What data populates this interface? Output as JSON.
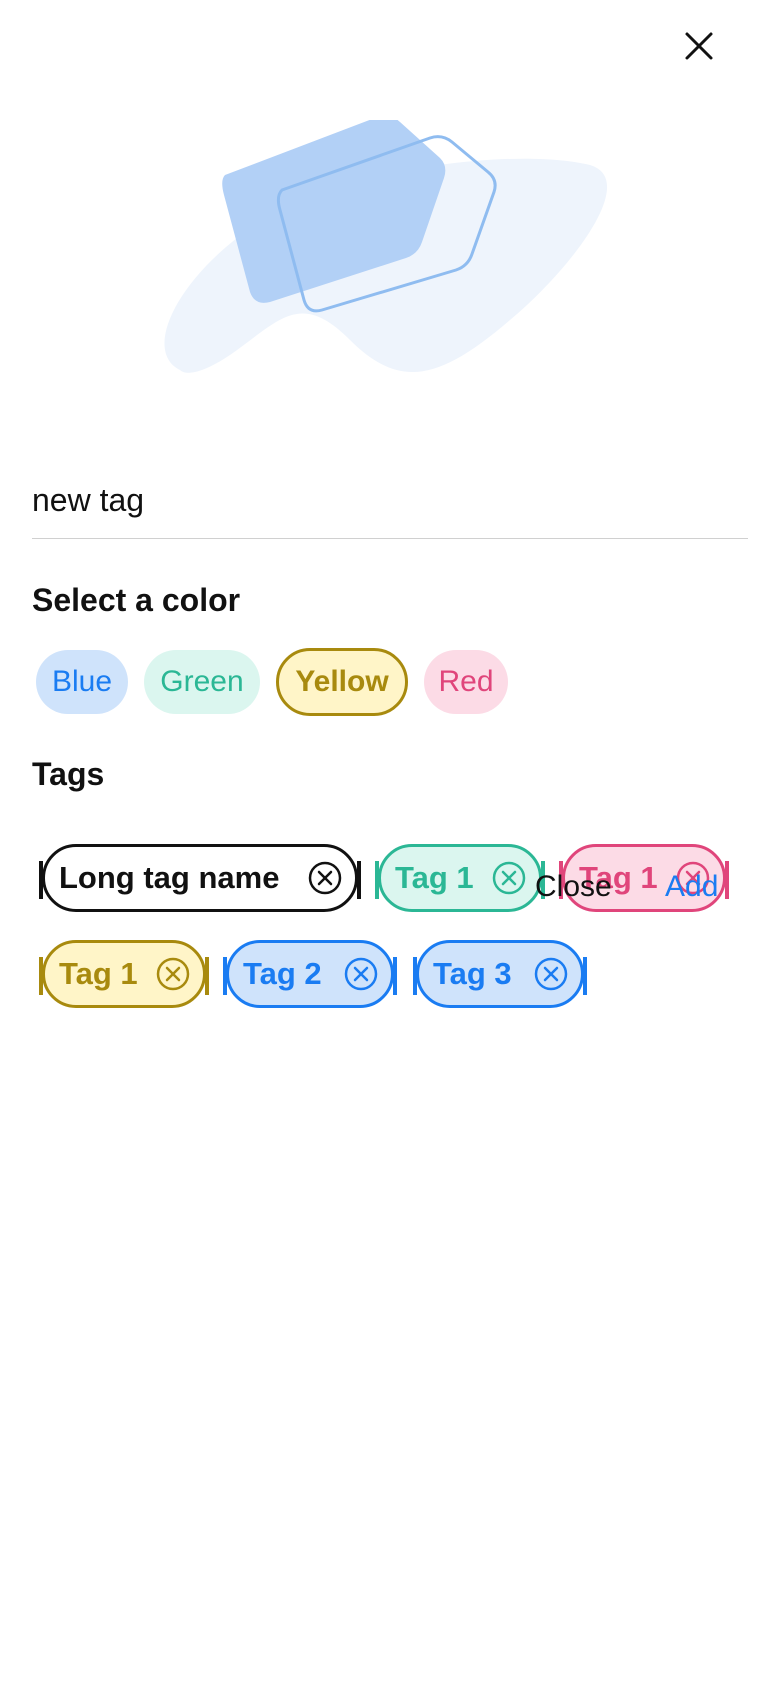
{
  "header": {
    "close_icon": "close-icon"
  },
  "form": {
    "tag_name_value": "new tag"
  },
  "colors": {
    "title": "Select a color",
    "options": [
      {
        "label": "Blue",
        "color": "#1a7cf2",
        "bg": "#cfe3fb",
        "selected": false
      },
      {
        "label": "Green",
        "color": "#2bb795",
        "bg": "#dbf6ef",
        "selected": false
      },
      {
        "label": "Yellow",
        "color": "#a88a0e",
        "bg": "#fff5c8",
        "selected": true
      },
      {
        "label": "Red",
        "color": "#e0457b",
        "bg": "#fcdbe6",
        "selected": false
      }
    ]
  },
  "tags": {
    "title": "Tags",
    "items": [
      {
        "label": "Long tag name",
        "color": "#111111",
        "bg": "#ffffff"
      },
      {
        "label": "Tag 1",
        "color": "#2bb795",
        "bg": "#dbf6ef"
      },
      {
        "label": "Tag 1",
        "color": "#e0457b",
        "bg": "#fcdbe6"
      },
      {
        "label": "Tag 1",
        "color": "#a88a0e",
        "bg": "#fff5c8"
      },
      {
        "label": "Tag 2",
        "color": "#1a7cf2",
        "bg": "#cfe3fb"
      },
      {
        "label": "Tag 3",
        "color": "#1a7cf2",
        "bg": "#cfe3fb"
      }
    ]
  },
  "actions": {
    "close_label": "Close",
    "add_label": "Add",
    "add_color": "#1a7cf2"
  }
}
